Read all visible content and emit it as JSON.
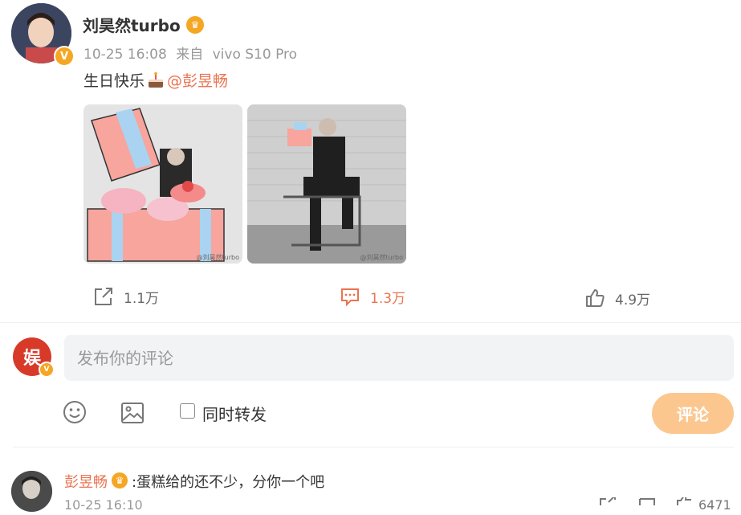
{
  "post": {
    "author": "刘昊然turbo",
    "time": "10-25 16:08",
    "source_prefix": "来自",
    "source": "vivo S10 Pro",
    "text": "生日快乐",
    "mention": "@彭昱畅",
    "images": [
      {
        "watermark": "@刘昊然turbo"
      },
      {
        "watermark": "@刘昊然turbo"
      }
    ]
  },
  "actions": {
    "repost_count": "1.1万",
    "comment_count": "1.3万",
    "like_count": "4.9万"
  },
  "composer": {
    "avatar_text": "娱",
    "placeholder": "发布你的评论",
    "repost_label": "同时转发",
    "submit_label": "评论"
  },
  "comment": {
    "user": "彭昱畅",
    "text": ":蛋糕给的还不少，分你一个吧",
    "time": "10-25 16:10",
    "like_count": "6471"
  },
  "colors": {
    "accent": "#eb7350",
    "badge": "#f5a623",
    "submit_disabled": "#fcc78f"
  },
  "icons": {
    "verified": "V",
    "crown": "♛"
  }
}
